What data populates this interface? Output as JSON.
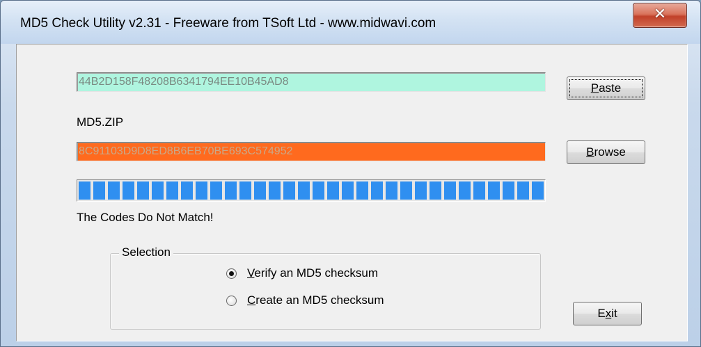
{
  "window": {
    "title": "MD5 Check Utility v2.31 - Freeware from TSoft Ltd - www.midwavi.com"
  },
  "fields": {
    "expected_checksum": "44B2D158F48208B6341794EE10B45AD8",
    "computed_checksum": "8C91103D9D8ED8B6EB70BE693C574952",
    "file_name": "MD5.ZIP"
  },
  "buttons": {
    "paste": {
      "mnemonic": "P",
      "rest": "aste"
    },
    "browse": {
      "mnemonic": "B",
      "rest": "rowse"
    },
    "exit": {
      "pre": "E",
      "mnemonic": "x",
      "rest": "it"
    }
  },
  "progress": {
    "value_percent": 100
  },
  "status": {
    "text": "The Codes Do Not Match!"
  },
  "selection": {
    "title": "Selection",
    "options": [
      {
        "mnemonic": "V",
        "rest": "erify an MD5 checksum",
        "selected": true
      },
      {
        "mnemonic": "C",
        "rest": "reate an MD5 checksum",
        "selected": false
      }
    ]
  },
  "colors": {
    "match_field": "#aff5df",
    "computed_field": "#ff6a1e",
    "progress": "#2f8ff0"
  },
  "icons": {
    "close": "close-icon"
  }
}
